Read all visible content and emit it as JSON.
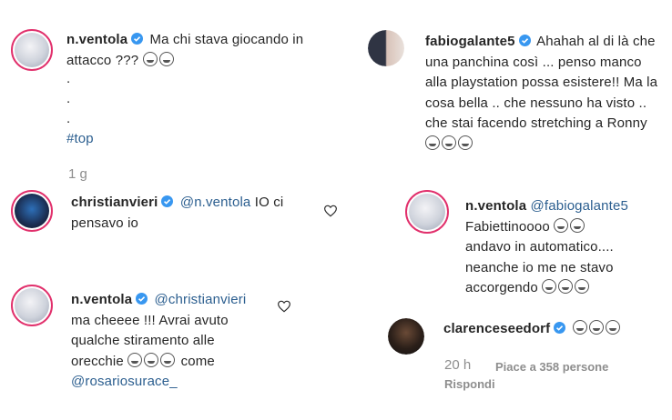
{
  "comments": [
    {
      "username": "n.ventola",
      "text": "Ma chi stava giocando in attacco ???",
      "dots": [
        ".",
        ".",
        "."
      ],
      "hashtag": "#top",
      "time": "1 g"
    },
    {
      "username": "christianvieri",
      "mention": "@n.ventola",
      "text": "IO ci pensavo io"
    },
    {
      "username": "n.ventola",
      "mention": "@christianvieri",
      "text": "ma cheeee !!! Avrai avuto qualche stiramento alle orecchie",
      "text_after": "come",
      "mention_end": "@rosariosurace_"
    },
    {
      "username": "fabiogalante5",
      "text": "Ahahah al di là che una panchina così ... penso manco alla playstation possa esistere!! Ma la cosa bella .. che nessuno ha visto .. che stai facendo stretching a Ronny"
    },
    {
      "username": "n.ventola",
      "mention": "@fabiogalante5",
      "text": "Fabiettinoooo",
      "text2": "andavo in automatico.... neanche io me ne stavo accorgendo"
    },
    {
      "username": "clarenceseedorf",
      "time": "20 h",
      "likes": "Piace a 358 persone",
      "reply": "Rispondi"
    }
  ],
  "icons": {
    "verified": "verified-badge-icon",
    "heart": "heart-outline-icon",
    "emoji": "laughing-emoji-icon"
  },
  "colors": {
    "mention": "#2b5e8f",
    "verified": "#3897f0",
    "story_ring": "#e1306c",
    "meta": "#8e8e8e"
  }
}
